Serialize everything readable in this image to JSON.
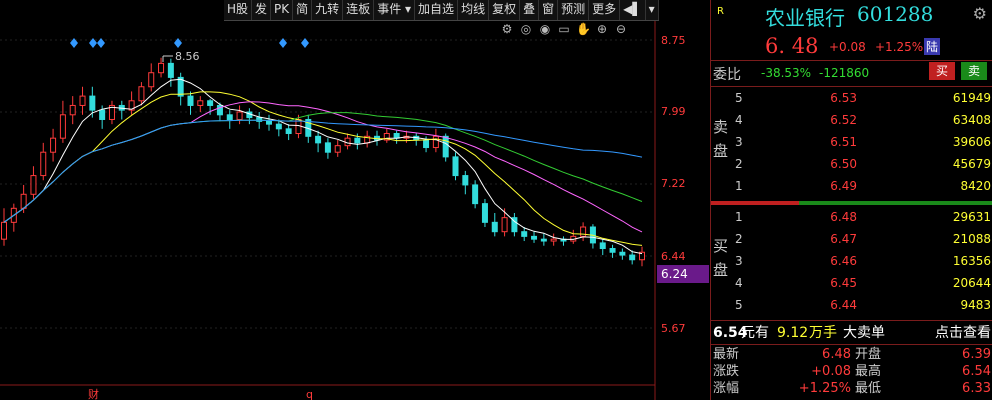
{
  "toolbar": {
    "items": [
      "H股",
      "发",
      "PK",
      "简",
      "九转",
      "连板",
      "事件 ▾",
      "加自选",
      "均线",
      "复权",
      "叠",
      "窗",
      "预测",
      "更多",
      "◀▌",
      "▾"
    ]
  },
  "chart_data": {
    "type": "candlestick",
    "yticks": [
      "8.75",
      "7.99",
      "7.22",
      "6.44",
      "5.67"
    ],
    "ylim": [
      5.67,
      8.75
    ],
    "high_label": "8.56",
    "current_price_label": "6.24",
    "markers_bottom": [
      "财",
      "q"
    ],
    "candles": [
      [
        6.62,
        6.8,
        6.55,
        6.95
      ],
      [
        6.8,
        6.95,
        6.7,
        7.0
      ],
      [
        6.95,
        7.1,
        6.9,
        7.2
      ],
      [
        7.1,
        7.3,
        7.05,
        7.4
      ],
      [
        7.3,
        7.55,
        7.25,
        7.65
      ],
      [
        7.55,
        7.7,
        7.45,
        7.8
      ],
      [
        7.7,
        7.95,
        7.65,
        8.1
      ],
      [
        7.95,
        8.05,
        7.85,
        8.15
      ],
      [
        8.05,
        8.15,
        7.95,
        8.25
      ],
      [
        8.15,
        8.0,
        7.92,
        8.25
      ],
      [
        8.0,
        7.9,
        7.8,
        8.05
      ],
      [
        7.9,
        8.05,
        7.85,
        8.1
      ],
      [
        8.05,
        8.0,
        7.9,
        8.1
      ],
      [
        8.0,
        8.1,
        7.95,
        8.2
      ],
      [
        8.1,
        8.25,
        8.05,
        8.3
      ],
      [
        8.25,
        8.4,
        8.2,
        8.5
      ],
      [
        8.4,
        8.5,
        8.35,
        8.56
      ],
      [
        8.5,
        8.35,
        8.25,
        8.55
      ],
      [
        8.35,
        8.15,
        8.05,
        8.4
      ],
      [
        8.15,
        8.05,
        7.95,
        8.2
      ],
      [
        8.05,
        8.1,
        7.98,
        8.15
      ],
      [
        8.1,
        8.05,
        7.95,
        8.12
      ],
      [
        8.05,
        7.95,
        7.88,
        8.08
      ],
      [
        7.95,
        7.9,
        7.8,
        8.0
      ],
      [
        7.9,
        7.98,
        7.85,
        8.05
      ],
      [
        7.98,
        7.92,
        7.85,
        8.02
      ],
      [
        7.92,
        7.88,
        7.8,
        7.98
      ],
      [
        7.88,
        7.85,
        7.78,
        7.95
      ],
      [
        7.85,
        7.8,
        7.72,
        7.9
      ],
      [
        7.8,
        7.75,
        7.68,
        7.85
      ],
      [
        7.75,
        7.9,
        7.7,
        7.95
      ],
      [
        7.9,
        7.72,
        7.65,
        7.95
      ],
      [
        7.72,
        7.65,
        7.55,
        7.78
      ],
      [
        7.65,
        7.55,
        7.48,
        7.7
      ],
      [
        7.55,
        7.62,
        7.5,
        7.68
      ],
      [
        7.62,
        7.7,
        7.58,
        7.75
      ],
      [
        7.7,
        7.65,
        7.58,
        7.75
      ],
      [
        7.65,
        7.72,
        7.6,
        7.78
      ],
      [
        7.72,
        7.68,
        7.62,
        7.78
      ],
      [
        7.68,
        7.75,
        7.65,
        7.8
      ],
      [
        7.75,
        7.7,
        7.64,
        7.78
      ],
      [
        7.7,
        7.72,
        7.65,
        7.78
      ],
      [
        7.72,
        7.68,
        7.62,
        7.76
      ],
      [
        7.68,
        7.6,
        7.55,
        7.72
      ],
      [
        7.6,
        7.72,
        7.55,
        7.8
      ],
      [
        7.72,
        7.5,
        7.45,
        7.75
      ],
      [
        7.5,
        7.3,
        7.25,
        7.55
      ],
      [
        7.3,
        7.2,
        7.1,
        7.35
      ],
      [
        7.2,
        7.0,
        6.95,
        7.25
      ],
      [
        7.0,
        6.8,
        6.75,
        7.05
      ],
      [
        6.8,
        6.7,
        6.65,
        6.9
      ],
      [
        6.7,
        6.85,
        6.65,
        6.95
      ],
      [
        6.85,
        6.7,
        6.65,
        6.9
      ],
      [
        6.7,
        6.65,
        6.6,
        6.75
      ],
      [
        6.65,
        6.62,
        6.58,
        6.7
      ],
      [
        6.62,
        6.6,
        6.55,
        6.68
      ],
      [
        6.6,
        6.62,
        6.55,
        6.68
      ],
      [
        6.62,
        6.6,
        6.55,
        6.65
      ],
      [
        6.6,
        6.65,
        6.57,
        6.72
      ],
      [
        6.65,
        6.75,
        6.6,
        6.8
      ],
      [
        6.75,
        6.58,
        6.52,
        6.78
      ],
      [
        6.58,
        6.52,
        6.45,
        6.62
      ],
      [
        6.52,
        6.48,
        6.42,
        6.56
      ],
      [
        6.48,
        6.45,
        6.4,
        6.52
      ],
      [
        6.45,
        6.4,
        6.35,
        6.5
      ],
      [
        6.4,
        6.48,
        6.33,
        6.54
      ]
    ]
  },
  "quote": {
    "market_tag": "R",
    "name": "农业银行",
    "code": "601288",
    "price": "6. 48",
    "change": "+0.08",
    "change_pct": "+1.25%",
    "exchange_badge": "陆",
    "weibi_label": "委比",
    "weibi_pct": "-38.53%",
    "weibi_vol": "-121860",
    "buy_btn": "买",
    "sell_btn": "卖"
  },
  "orderbook": {
    "sell_label": [
      "卖",
      "盘"
    ],
    "buy_label": [
      "买",
      "盘"
    ],
    "asks": [
      {
        "level": "5",
        "price": "6.53",
        "volume": "61949"
      },
      {
        "level": "4",
        "price": "6.52",
        "volume": "63408"
      },
      {
        "level": "3",
        "price": "6.51",
        "volume": "39606"
      },
      {
        "level": "2",
        "price": "6.50",
        "volume": "45679"
      },
      {
        "level": "1",
        "price": "6.49",
        "volume": "8420"
      }
    ],
    "bids": [
      {
        "level": "1",
        "price": "6.48",
        "volume": "29631"
      },
      {
        "level": "2",
        "price": "6.47",
        "volume": "21088"
      },
      {
        "level": "3",
        "price": "6.46",
        "volume": "16356"
      },
      {
        "level": "4",
        "price": "6.45",
        "volume": "20644"
      },
      {
        "level": "5",
        "price": "6.44",
        "volume": "9483"
      }
    ]
  },
  "big_order": {
    "price": "6.54",
    "prefix": "元有",
    "amount": "9.12",
    "unit": "万手",
    "text": "大卖单",
    "link": "点击查看"
  },
  "stats": [
    {
      "label": "最新",
      "value": "6.48",
      "label2": "开盘",
      "value2": "6.39"
    },
    {
      "label": "涨跌",
      "value": "+0.08",
      "label2": "最高",
      "value2": "6.54"
    },
    {
      "label": "涨幅",
      "value": "+1.25%",
      "label2": "最低",
      "value2": "6.33"
    }
  ],
  "colors": {
    "up": "#ff3b3b",
    "down": "#33dddd",
    "yellow": "#ffff33",
    "green": "#33dd33"
  }
}
